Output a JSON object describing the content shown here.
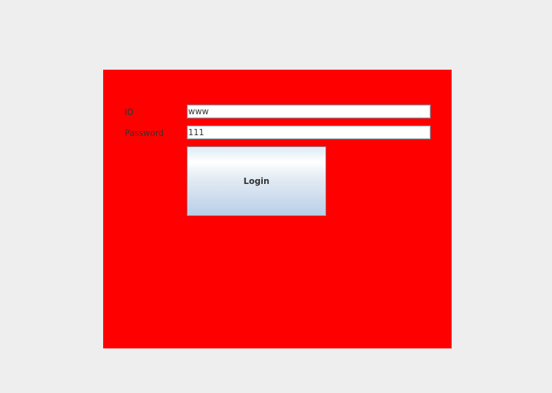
{
  "form": {
    "id_label": "ID",
    "id_value": "www",
    "password_label": "Password",
    "password_value": "111",
    "login_label": "Login"
  },
  "colors": {
    "panel_background": "#ff0000",
    "window_background": "#eeeeee"
  }
}
